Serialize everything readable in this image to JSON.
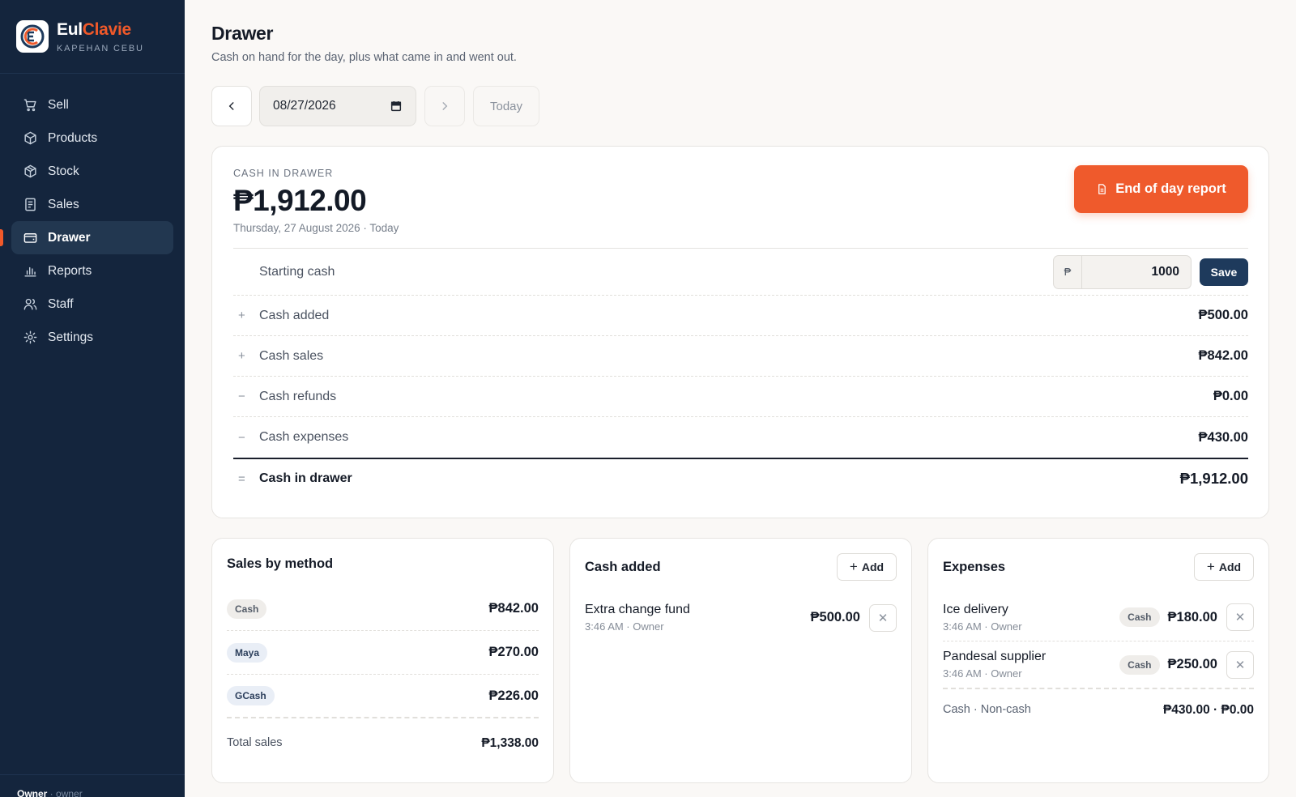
{
  "brand": {
    "name_a": "Eul",
    "name_b": "Clavie",
    "subtitle": "KAPEHAN CEBU"
  },
  "nav": [
    {
      "label": "Sell",
      "icon": "cart-icon"
    },
    {
      "label": "Products",
      "icon": "box-icon"
    },
    {
      "label": "Stock",
      "icon": "package-icon"
    },
    {
      "label": "Sales",
      "icon": "receipt-icon"
    },
    {
      "label": "Drawer",
      "icon": "wallet-icon",
      "active": true
    },
    {
      "label": "Reports",
      "icon": "bar-chart-icon"
    },
    {
      "label": "Staff",
      "icon": "users-icon"
    },
    {
      "label": "Settings",
      "icon": "gear-icon"
    }
  ],
  "footer": {
    "user": "Owner",
    "separator": " · ",
    "role": "owner"
  },
  "page": {
    "title": "Drawer",
    "subtitle": "Cash on hand for the day, plus what came in and went out."
  },
  "datebar": {
    "date": "08/27/2026",
    "today_label": "Today"
  },
  "drawer": {
    "label": "CASH IN DRAWER",
    "amount": "₱1,912.00",
    "date_text": "Thursday, 27 August 2026 · Today",
    "eod_label": "End of day report",
    "starting_cash_label": "Starting cash",
    "currency_symbol": "₱",
    "starting_cash_value": "1000",
    "save_label": "Save",
    "rows": [
      {
        "sign": "+",
        "label": "Cash added",
        "value": "₱500.00"
      },
      {
        "sign": "+",
        "label": "Cash sales",
        "value": "₱842.00"
      },
      {
        "sign": "−",
        "label": "Cash refunds",
        "value": "₱0.00"
      },
      {
        "sign": "−",
        "label": "Cash expenses",
        "value": "₱430.00"
      }
    ],
    "total": {
      "sign": "=",
      "label": "Cash in drawer",
      "value": "₱1,912.00"
    }
  },
  "sales_by_method": {
    "title": "Sales by method",
    "methods": [
      {
        "name": "Cash",
        "value": "₱842.00"
      },
      {
        "name": "Maya",
        "value": "₱270.00"
      },
      {
        "name": "GCash",
        "value": "₱226.00"
      }
    ],
    "total_label": "Total sales",
    "total_value": "₱1,338.00"
  },
  "cash_added": {
    "title": "Cash added",
    "add_label": "Add",
    "entries": [
      {
        "name": "Extra change fund",
        "meta": "3:46 AM · Owner",
        "value": "₱500.00"
      }
    ]
  },
  "expenses": {
    "title": "Expenses",
    "add_label": "Add",
    "entries": [
      {
        "name": "Ice delivery",
        "meta": "3:46 AM · Owner",
        "method": "Cash",
        "value": "₱180.00"
      },
      {
        "name": "Pandesal supplier",
        "meta": "3:46 AM · Owner",
        "method": "Cash",
        "value": "₱250.00"
      }
    ],
    "footer_label": "Cash · Non-cash",
    "footer_value": "₱430.00 · ₱0.00"
  },
  "colors": {
    "accent": "#ef5a2c",
    "sidebar": "#14253d",
    "save": "#1e3a5c"
  }
}
